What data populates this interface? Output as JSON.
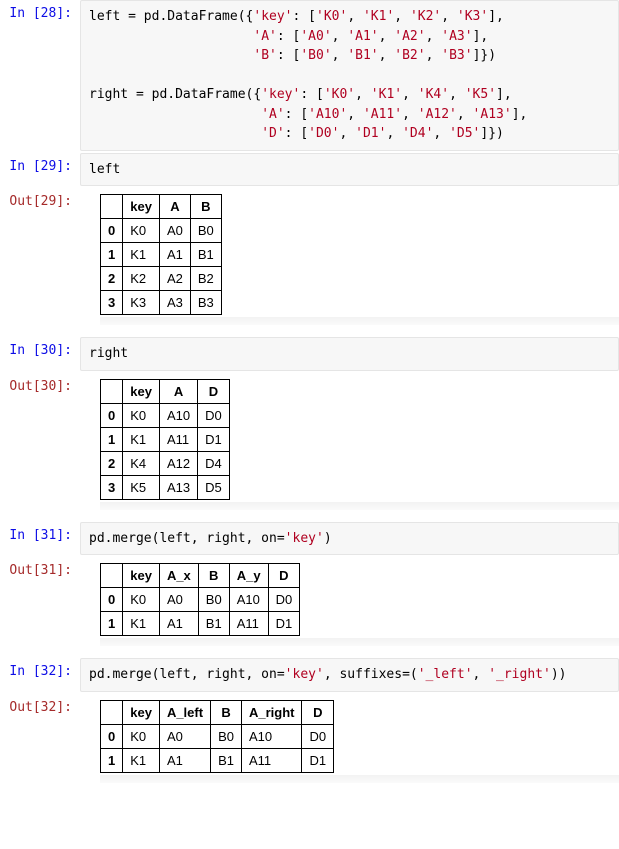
{
  "cells": [
    {
      "n": 28,
      "in_prompt": "In  [28]:",
      "code_tokens": [
        {
          "t": "left ",
          "c": "tok-kw"
        },
        {
          "t": "= pd.DataFrame({",
          "c": "tok-op"
        },
        {
          "t": "'key'",
          "c": "tok-str"
        },
        {
          "t": ": [",
          "c": "tok-op"
        },
        {
          "t": "'K0'",
          "c": "tok-str"
        },
        {
          "t": ", ",
          "c": "tok-op"
        },
        {
          "t": "'K1'",
          "c": "tok-str"
        },
        {
          "t": ", ",
          "c": "tok-op"
        },
        {
          "t": "'K2'",
          "c": "tok-str"
        },
        {
          "t": ", ",
          "c": "tok-op"
        },
        {
          "t": "'K3'",
          "c": "tok-str"
        },
        {
          "t": "],",
          "c": "tok-op"
        },
        {
          "t": "\n                     ",
          "c": "tok-op"
        },
        {
          "t": "'A'",
          "c": "tok-str"
        },
        {
          "t": ": [",
          "c": "tok-op"
        },
        {
          "t": "'A0'",
          "c": "tok-str"
        },
        {
          "t": ", ",
          "c": "tok-op"
        },
        {
          "t": "'A1'",
          "c": "tok-str"
        },
        {
          "t": ", ",
          "c": "tok-op"
        },
        {
          "t": "'A2'",
          "c": "tok-str"
        },
        {
          "t": ", ",
          "c": "tok-op"
        },
        {
          "t": "'A3'",
          "c": "tok-str"
        },
        {
          "t": "],",
          "c": "tok-op"
        },
        {
          "t": "\n                     ",
          "c": "tok-op"
        },
        {
          "t": "'B'",
          "c": "tok-str"
        },
        {
          "t": ": [",
          "c": "tok-op"
        },
        {
          "t": "'B0'",
          "c": "tok-str"
        },
        {
          "t": ", ",
          "c": "tok-op"
        },
        {
          "t": "'B1'",
          "c": "tok-str"
        },
        {
          "t": ", ",
          "c": "tok-op"
        },
        {
          "t": "'B2'",
          "c": "tok-str"
        },
        {
          "t": ", ",
          "c": "tok-op"
        },
        {
          "t": "'B3'",
          "c": "tok-str"
        },
        {
          "t": "]})",
          "c": "tok-op"
        },
        {
          "t": "\n\nright ",
          "c": "tok-kw"
        },
        {
          "t": "= pd.DataFrame({",
          "c": "tok-op"
        },
        {
          "t": "'key'",
          "c": "tok-str"
        },
        {
          "t": ": [",
          "c": "tok-op"
        },
        {
          "t": "'K0'",
          "c": "tok-str"
        },
        {
          "t": ", ",
          "c": "tok-op"
        },
        {
          "t": "'K1'",
          "c": "tok-str"
        },
        {
          "t": ", ",
          "c": "tok-op"
        },
        {
          "t": "'K4'",
          "c": "tok-str"
        },
        {
          "t": ", ",
          "c": "tok-op"
        },
        {
          "t": "'K5'",
          "c": "tok-str"
        },
        {
          "t": "],",
          "c": "tok-op"
        },
        {
          "t": "\n                      ",
          "c": "tok-op"
        },
        {
          "t": "'A'",
          "c": "tok-str"
        },
        {
          "t": ": [",
          "c": "tok-op"
        },
        {
          "t": "'A10'",
          "c": "tok-str"
        },
        {
          "t": ", ",
          "c": "tok-op"
        },
        {
          "t": "'A11'",
          "c": "tok-str"
        },
        {
          "t": ", ",
          "c": "tok-op"
        },
        {
          "t": "'A12'",
          "c": "tok-str"
        },
        {
          "t": ", ",
          "c": "tok-op"
        },
        {
          "t": "'A13'",
          "c": "tok-str"
        },
        {
          "t": "],",
          "c": "tok-op"
        },
        {
          "t": "\n                      ",
          "c": "tok-op"
        },
        {
          "t": "'D'",
          "c": "tok-str"
        },
        {
          "t": ": [",
          "c": "tok-op"
        },
        {
          "t": "'D0'",
          "c": "tok-str"
        },
        {
          "t": ", ",
          "c": "tok-op"
        },
        {
          "t": "'D1'",
          "c": "tok-str"
        },
        {
          "t": ", ",
          "c": "tok-op"
        },
        {
          "t": "'D4'",
          "c": "tok-str"
        },
        {
          "t": ", ",
          "c": "tok-op"
        },
        {
          "t": "'D5'",
          "c": "tok-str"
        },
        {
          "t": "]})",
          "c": "tok-op"
        }
      ]
    },
    {
      "n": 29,
      "in_prompt": "In  [29]:",
      "out_prompt": "Out[29]:",
      "code_tokens": [
        {
          "t": "left",
          "c": "tok-kw"
        }
      ],
      "table": {
        "columns": [
          "key",
          "A",
          "B"
        ],
        "index": [
          "0",
          "1",
          "2",
          "3"
        ],
        "rows": [
          [
            "K0",
            "A0",
            "B0"
          ],
          [
            "K1",
            "A1",
            "B1"
          ],
          [
            "K2",
            "A2",
            "B2"
          ],
          [
            "K3",
            "A3",
            "B3"
          ]
        ]
      }
    },
    {
      "n": 30,
      "in_prompt": "In  [30]:",
      "out_prompt": "Out[30]:",
      "code_tokens": [
        {
          "t": "right",
          "c": "tok-kw"
        }
      ],
      "table": {
        "columns": [
          "key",
          "A",
          "D"
        ],
        "index": [
          "0",
          "1",
          "2",
          "3"
        ],
        "rows": [
          [
            "K0",
            "A10",
            "D0"
          ],
          [
            "K1",
            "A11",
            "D1"
          ],
          [
            "K4",
            "A12",
            "D4"
          ],
          [
            "K5",
            "A13",
            "D5"
          ]
        ]
      }
    },
    {
      "n": 31,
      "in_prompt": "In  [31]:",
      "out_prompt": "Out[31]:",
      "code_tokens": [
        {
          "t": "pd.merge(left, right, on=",
          "c": "tok-fn"
        },
        {
          "t": "'key'",
          "c": "tok-str"
        },
        {
          "t": ")",
          "c": "tok-op"
        }
      ],
      "table": {
        "columns": [
          "key",
          "A_x",
          "B",
          "A_y",
          "D"
        ],
        "index": [
          "0",
          "1"
        ],
        "rows": [
          [
            "K0",
            "A0",
            "B0",
            "A10",
            "D0"
          ],
          [
            "K1",
            "A1",
            "B1",
            "A11",
            "D1"
          ]
        ]
      }
    },
    {
      "n": 32,
      "in_prompt": "In  [32]:",
      "out_prompt": "Out[32]:",
      "code_tokens": [
        {
          "t": "pd.merge(left, right, on=",
          "c": "tok-fn"
        },
        {
          "t": "'key'",
          "c": "tok-str"
        },
        {
          "t": ", suffixes=(",
          "c": "tok-fn"
        },
        {
          "t": "'_left'",
          "c": "tok-str"
        },
        {
          "t": ", ",
          "c": "tok-op"
        },
        {
          "t": "'_right'",
          "c": "tok-str"
        },
        {
          "t": "))",
          "c": "tok-op"
        }
      ],
      "table": {
        "columns": [
          "key",
          "A_left",
          "B",
          "A_right",
          "D"
        ],
        "index": [
          "0",
          "1"
        ],
        "rows": [
          [
            "K0",
            "A0",
            "B0",
            "A10",
            "D0"
          ],
          [
            "K1",
            "A1",
            "B1",
            "A11",
            "D1"
          ]
        ]
      }
    }
  ]
}
